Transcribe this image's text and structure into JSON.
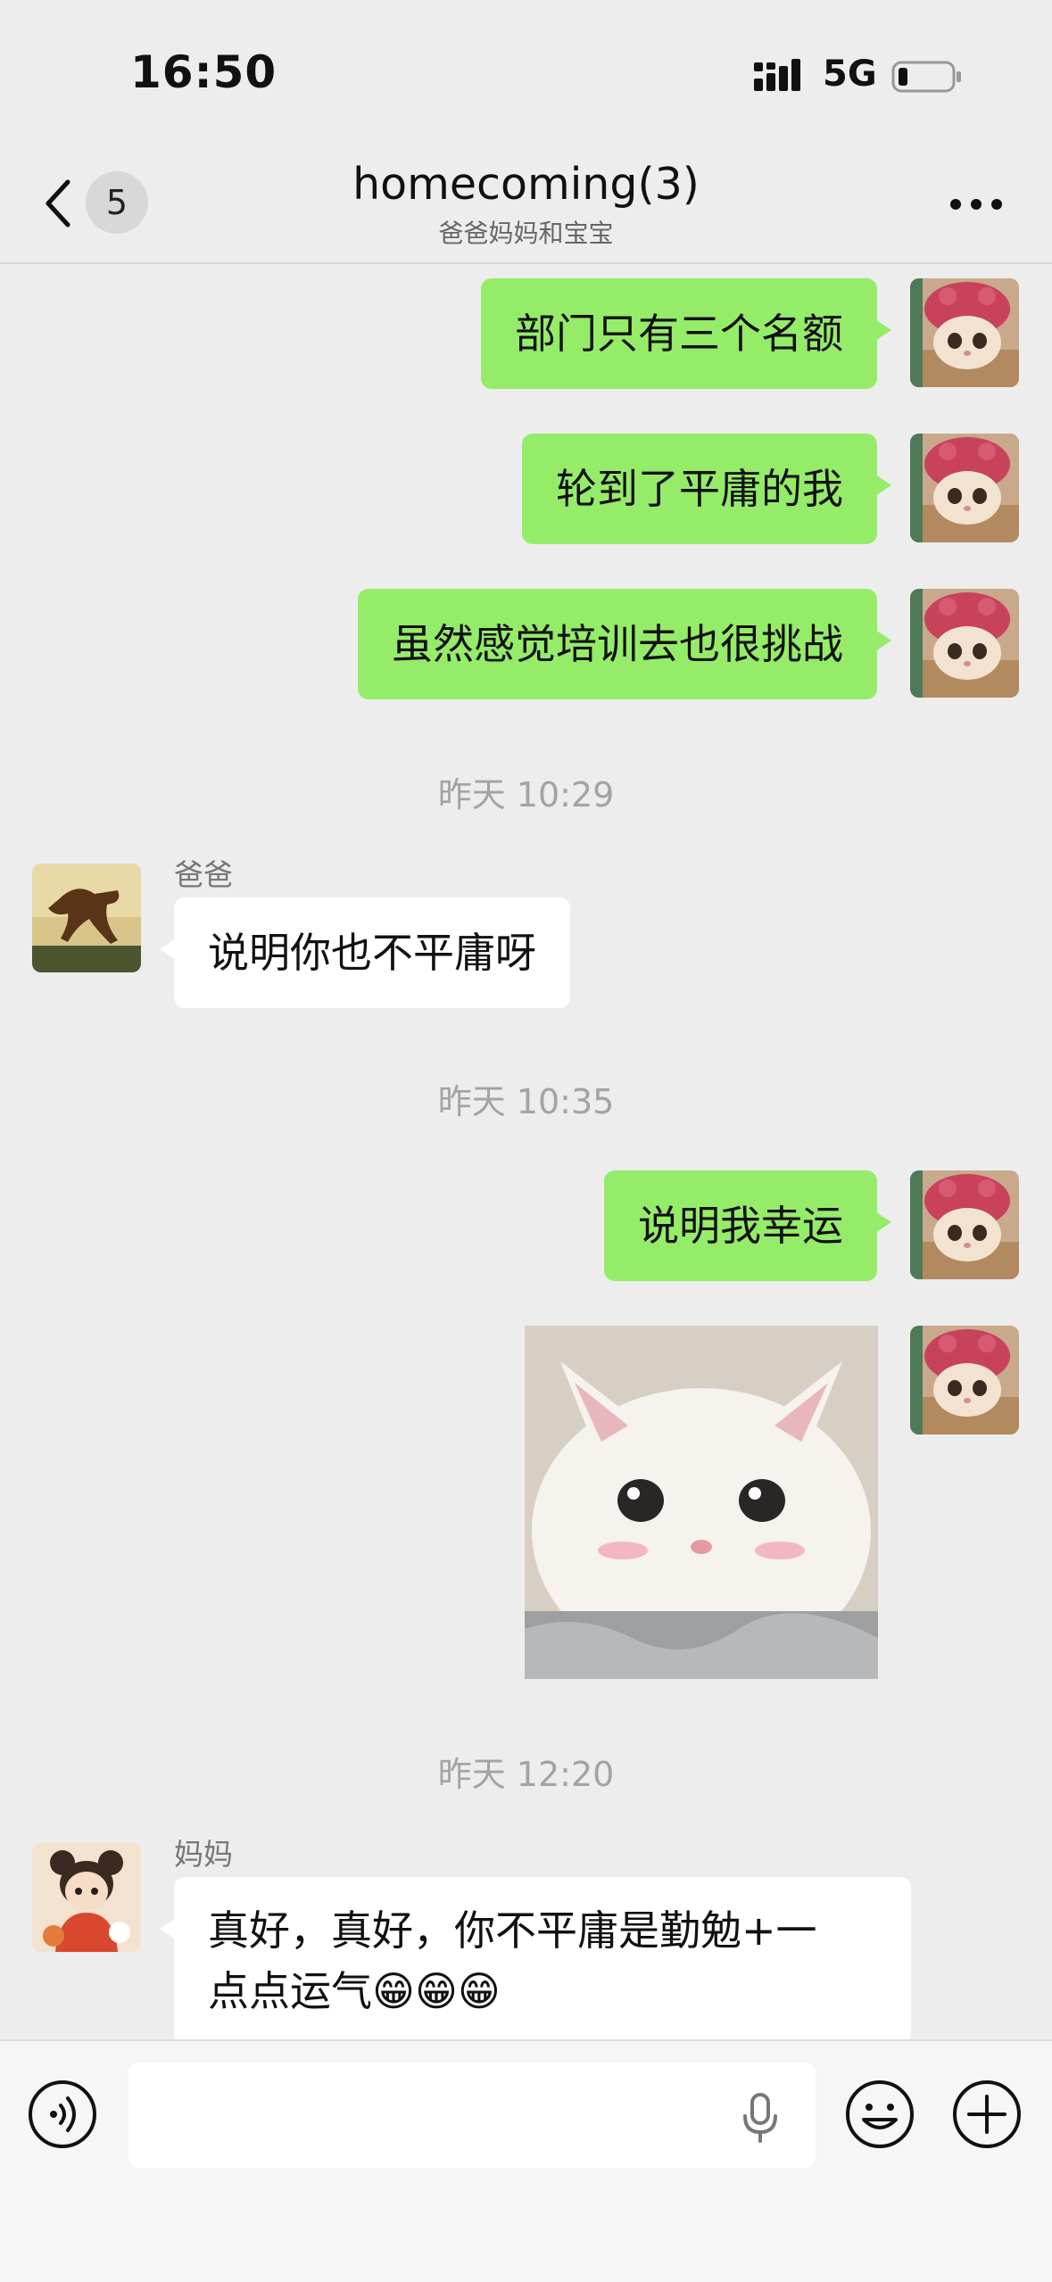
{
  "status_bar": {
    "time": "16:50",
    "network": "5G"
  },
  "header": {
    "unread_count": "5",
    "title": "homecoming(3)",
    "subtitle": "爸爸妈妈和宝宝"
  },
  "messages": [
    {
      "type": "text",
      "dir": "out",
      "text": "部门只有三个名额"
    },
    {
      "type": "text",
      "dir": "out",
      "text": "轮到了平庸的我"
    },
    {
      "type": "text",
      "dir": "out",
      "text": "虽然感觉培训去也很挑战"
    },
    {
      "type": "time",
      "text": "昨天 10:29"
    },
    {
      "type": "text",
      "dir": "in",
      "sender": "爸爸",
      "text": "说明你也不平庸呀"
    },
    {
      "type": "time",
      "text": "昨天 10:35"
    },
    {
      "type": "text",
      "dir": "out",
      "text": "说明我幸运"
    },
    {
      "type": "image",
      "dir": "out",
      "content": "white-kitten-sticker"
    },
    {
      "type": "time",
      "text": "昨天 12:20"
    },
    {
      "type": "text",
      "dir": "in",
      "sender": "妈妈",
      "line1": "真好，真好，你不平庸是勤勉+一",
      "line2": "点点运气😁😁😁"
    }
  ],
  "icons": {
    "back": "chevron-left-icon",
    "more": "more-dots-icon",
    "voice": "voice-icon",
    "mic": "microphone-icon",
    "emoji": "emoji-icon",
    "plus": "plus-icon"
  },
  "colors": {
    "out_bubble": "#95ec69",
    "in_bubble": "#ffffff",
    "background": "#ededed"
  }
}
